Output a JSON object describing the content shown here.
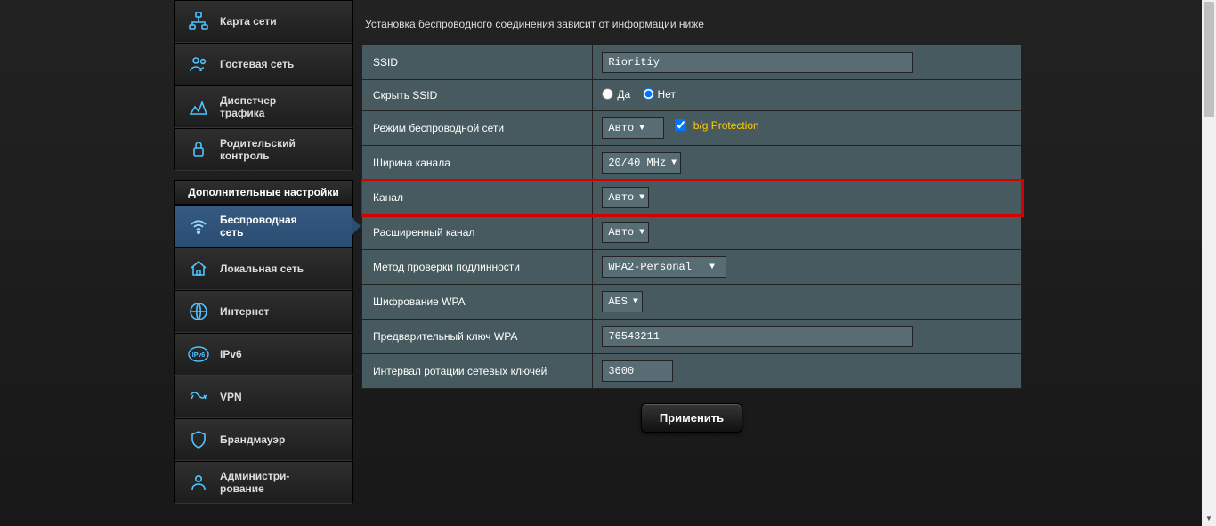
{
  "sidebar": {
    "general": [
      {
        "label": "Карта сети",
        "icon": "network-map"
      },
      {
        "label": "Гостевая сеть",
        "icon": "guest"
      },
      {
        "label": "Диспетчер\nтрафика",
        "icon": "traffic"
      },
      {
        "label": "Родительский\nконтроль",
        "icon": "parental"
      }
    ],
    "advanced_header": "Дополнительные настройки",
    "advanced": [
      {
        "label": "Беспроводная\nсеть",
        "icon": "wifi",
        "active": true
      },
      {
        "label": "Локальная сеть",
        "icon": "lan"
      },
      {
        "label": "Интернет",
        "icon": "internet"
      },
      {
        "label": "IPv6",
        "icon": "ipv6"
      },
      {
        "label": "VPN",
        "icon": "vpn"
      },
      {
        "label": "Брандмауэр",
        "icon": "firewall"
      },
      {
        "label": "Администри-\nрование",
        "icon": "admin"
      }
    ]
  },
  "main": {
    "intro": "Установка беспроводного соединения зависит от информации ниже",
    "fields": {
      "ssid_label": "SSID",
      "ssid_value": "Rioritiy",
      "hide_ssid_label": "Скрыть SSID",
      "hide_ssid_yes": "Да",
      "hide_ssid_no": "Нет",
      "wireless_mode_label": "Режим беспроводной сети",
      "wireless_mode_value": "Авто",
      "bg_protection": "b/g Protection",
      "channel_width_label": "Ширина канала",
      "channel_width_value": "20/40 MHz",
      "channel_label": "Канал",
      "channel_value": "Авто",
      "ext_channel_label": "Расширенный канал",
      "ext_channel_value": "Авто",
      "auth_label": "Метод проверки подлинности",
      "auth_value": "WPA2-Personal",
      "wpa_enc_label": "Шифрование WPA",
      "wpa_enc_value": "AES",
      "wpa_key_label": "Предварительный ключ WPA",
      "wpa_key_value": "76543211",
      "rotation_label": "Интервал ротации сетевых ключей",
      "rotation_value": "3600"
    },
    "apply": "Применить"
  }
}
